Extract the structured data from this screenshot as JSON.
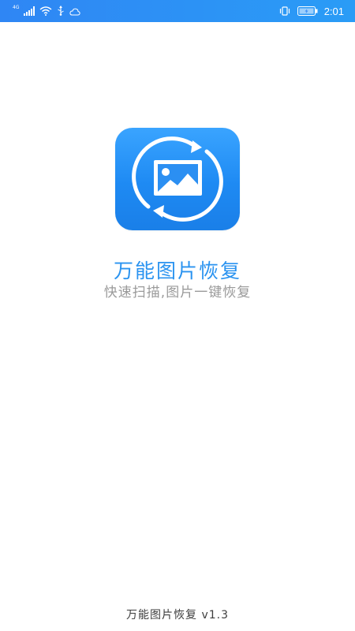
{
  "status_bar": {
    "network_label": "4G",
    "time": "2:01",
    "icons": [
      "signal-icon",
      "wifi-icon",
      "usb-icon",
      "cloud-icon",
      "vibrate-icon",
      "battery-icon"
    ],
    "accent_color": "#2f86f4"
  },
  "splash": {
    "title": "万能图片恢复",
    "subtitle": "快速扫描,图片一键恢复",
    "icon": "photo-restore-icon",
    "brand_color": "#2a93f0"
  },
  "footer": {
    "version_text": "万能图片恢复 v1.3"
  }
}
